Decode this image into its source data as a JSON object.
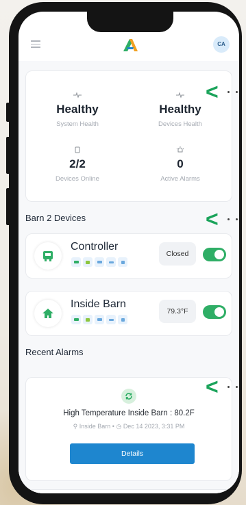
{
  "header": {
    "menu_icon": "hamburger-icon",
    "logo": "app-logo",
    "avatar_initials": "CA"
  },
  "summary": {
    "system_health": {
      "value": "Healthy",
      "label": "System Health",
      "icon": "pulse-icon"
    },
    "devices_health": {
      "value": "Healthy",
      "label": "Devices Health",
      "icon": "pulse-icon"
    },
    "devices_online": {
      "value": "2/2",
      "label": "Devices Online",
      "icon": "device-icon"
    },
    "active_alarms": {
      "value": "0",
      "label": "Active Alarms",
      "icon": "alarm-bell-icon"
    }
  },
  "devices_section_title": "Barn 2 Devices",
  "devices": [
    {
      "name": "Controller",
      "status": "Closed",
      "icon": "controller-icon",
      "toggle_on": true
    },
    {
      "name": "Inside Barn",
      "status": "79.3°F",
      "icon": "home-icon",
      "toggle_on": true
    }
  ],
  "alarms_section_title": "Recent Alarms",
  "alarm": {
    "icon": "refresh-icon",
    "title": "High Temperature Inside Barn : 80.2F",
    "location": "Inside Barn",
    "separator": "•",
    "timestamp": "Dec 14 2023, 3:31 PM",
    "details_label": "Details"
  },
  "colors": {
    "accent_green": "#2fae66",
    "button_blue": "#1e86cf",
    "arrow_green": "#1aa35a"
  }
}
